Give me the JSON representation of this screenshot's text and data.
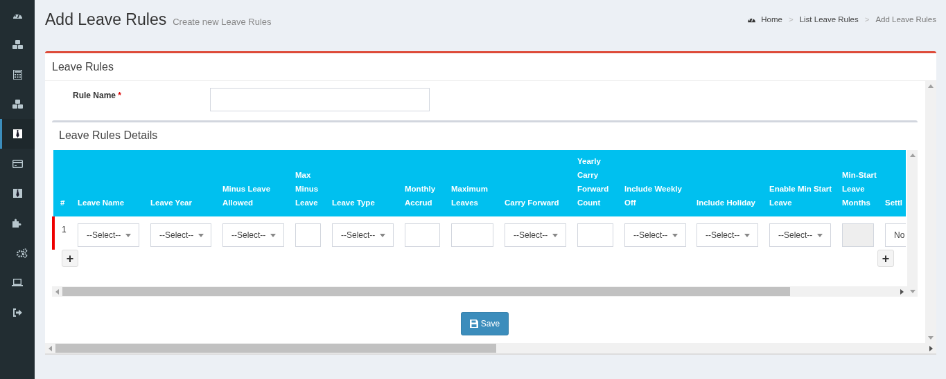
{
  "sidebar": {
    "items": [
      {
        "selected": false
      },
      {
        "selected": false
      },
      {
        "selected": false
      },
      {
        "selected": false
      },
      {
        "selected": true
      },
      {
        "selected": false
      },
      {
        "selected": false
      },
      {
        "selected": false
      },
      {
        "selected": false
      },
      {
        "selected": false
      },
      {
        "selected": false
      }
    ]
  },
  "header": {
    "title": "Add Leave Rules",
    "subtitle": "Create new Leave Rules"
  },
  "breadcrumb": [
    {
      "label": "Home",
      "current": false
    },
    {
      "separator": ">",
      "label": "List Leave Rules",
      "current": false
    },
    {
      "separator": ">",
      "label": "Add Leave Rules",
      "current": true
    }
  ],
  "panel": {
    "title": "Leave Rules",
    "rule_name": {
      "label": "Rule Name",
      "required_mark": "*"
    },
    "details": {
      "title": "Leave Rules Details",
      "table": {
        "columns": [
          "#",
          "Leave Name",
          "Leave Year",
          "Minus Leave Allowed",
          "Max Minus Leave",
          "Leave Type",
          "Monthly Accrud",
          "Maximum Leaves",
          "Carry Forward",
          "Yearly Carry Forward Count",
          "Include Weekly Off",
          "Include Holiday",
          "Enable Min Start Leave",
          "Min-Start Leave Months",
          "Settl"
        ],
        "rows": [
          {
            "highlighted": true,
            "cells": [
              {
                "kind": "number",
                "value": "1"
              },
              {
                "kind": "select",
                "value": "--Select--"
              },
              {
                "kind": "select",
                "value": "--Select--"
              },
              {
                "kind": "select",
                "value": "--Select--"
              },
              {
                "kind": "text"
              },
              {
                "kind": "select",
                "value": "--Select--"
              },
              {
                "kind": "text"
              },
              {
                "kind": "text"
              },
              {
                "kind": "select",
                "value": "--Select--"
              },
              {
                "kind": "text"
              },
              {
                "kind": "select",
                "value": "--Select--"
              },
              {
                "kind": "select",
                "value": "--Select--"
              },
              {
                "kind": "select",
                "value": "--Select--"
              },
              {
                "kind": "disabled"
              },
              {
                "kind": "select",
                "value": "No"
              }
            ]
          }
        ]
      },
      "add_buttons": [
        "+",
        "+"
      ]
    },
    "save_button": "Save"
  }
}
